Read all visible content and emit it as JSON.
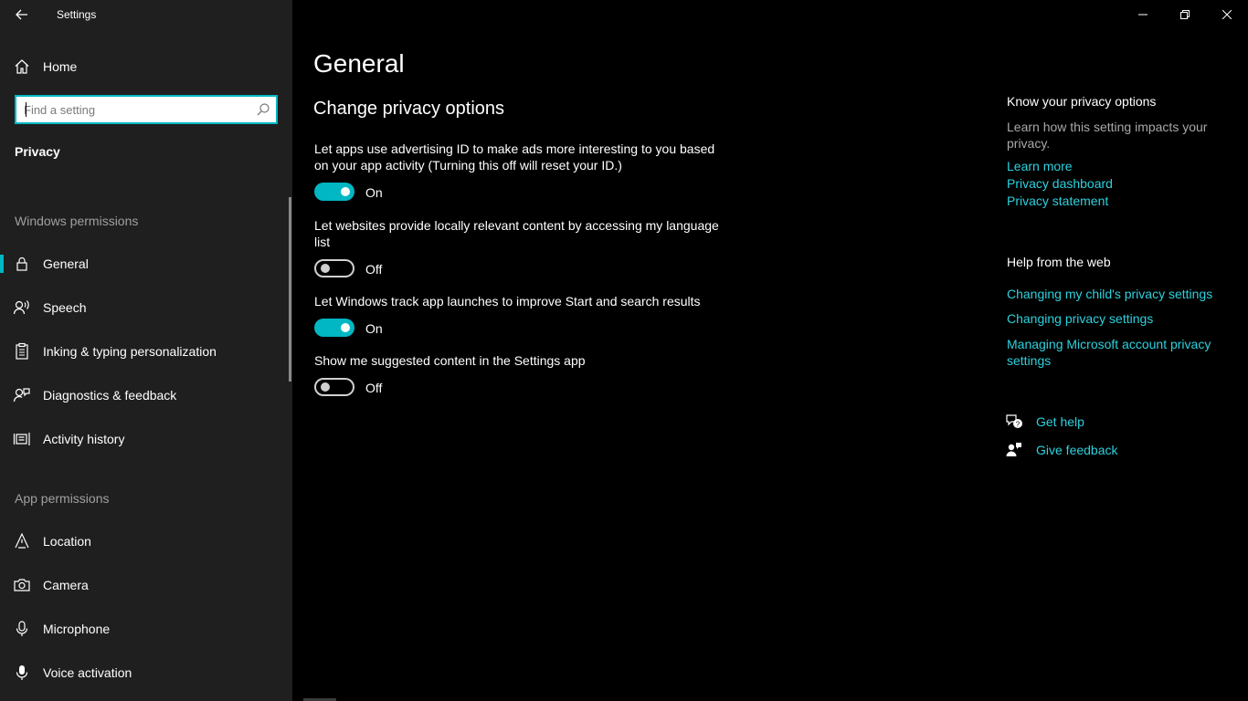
{
  "window": {
    "title": "Settings"
  },
  "sidebar": {
    "home_label": "Home",
    "search_placeholder": "Find a setting",
    "section_title": "Privacy",
    "windows_permissions_heading": "Windows permissions",
    "windows_items": [
      {
        "label": "General",
        "icon": "lock-icon",
        "selected": true
      },
      {
        "label": "Speech",
        "icon": "speech-icon"
      },
      {
        "label": "Inking & typing personalization",
        "icon": "clipboard-icon"
      },
      {
        "label": "Diagnostics & feedback",
        "icon": "diagnostics-icon"
      },
      {
        "label": "Activity history",
        "icon": "activity-history-icon"
      }
    ],
    "app_permissions_heading": "App permissions",
    "app_items": [
      {
        "label": "Location",
        "icon": "location-icon"
      },
      {
        "label": "Camera",
        "icon": "camera-icon"
      },
      {
        "label": "Microphone",
        "icon": "microphone-icon"
      },
      {
        "label": "Voice activation",
        "icon": "voice-activation-icon"
      }
    ]
  },
  "main": {
    "title": "General",
    "subtitle": "Change privacy options",
    "settings": [
      {
        "description": "Let apps use advertising ID to make ads more interesting to you based on your app activity (Turning this off will reset your ID.)",
        "state": "On"
      },
      {
        "description": "Let websites provide locally relevant content by accessing my language list",
        "state": "Off"
      },
      {
        "description": "Let Windows track app launches to improve Start and search results",
        "state": "On"
      },
      {
        "description": "Show me suggested content in the Settings app",
        "state": "Off"
      }
    ]
  },
  "right_pane": {
    "know_heading": "Know your privacy options",
    "know_text": "Learn how this setting impacts your privacy.",
    "know_links": [
      "Learn more",
      "Privacy dashboard",
      "Privacy statement"
    ],
    "web_heading": "Help from the web",
    "web_links": [
      "Changing my child's privacy settings",
      "Changing privacy settings",
      "Managing Microsoft account privacy settings"
    ],
    "get_help": "Get help",
    "give_feedback": "Give feedback"
  },
  "colors": {
    "accent": "#00b7c3",
    "link": "#2dd1de",
    "sidebar_bg": "#1f1f1f",
    "main_bg": "#000000"
  }
}
